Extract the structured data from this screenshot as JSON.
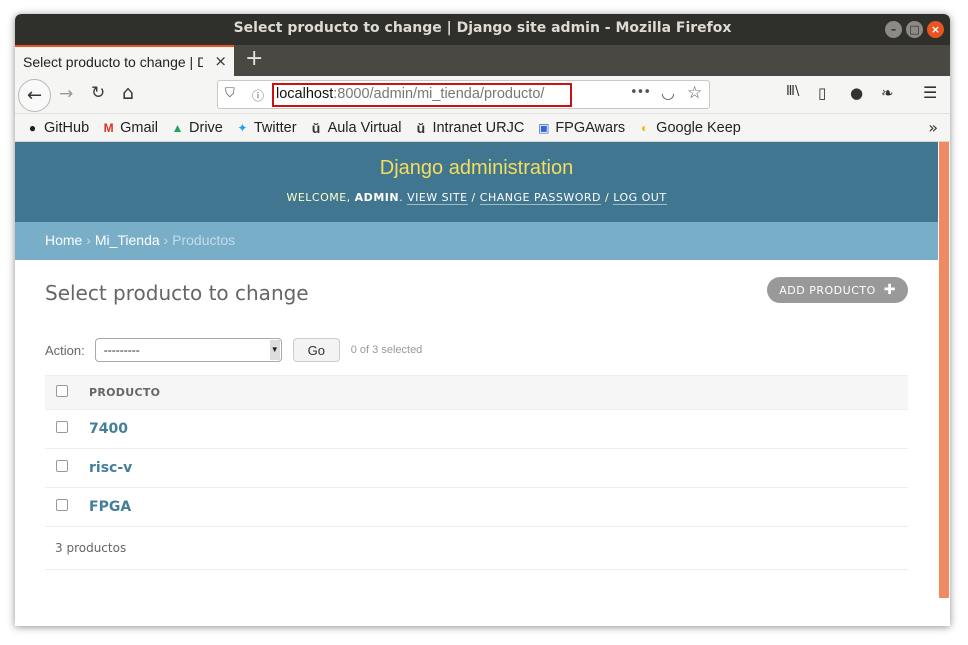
{
  "window": {
    "title": "Select producto to change | Django site admin - Mozilla Firefox",
    "controls": {
      "minimize": "–",
      "maximize": "□",
      "close": "×"
    }
  },
  "tabs": [
    {
      "label": "Select producto to change | Django site admin",
      "close": "×"
    }
  ],
  "new_tab": "+",
  "nav": {
    "back": "←",
    "forward": "→",
    "reload": "↻",
    "home": "⌂",
    "url_host": "localhost",
    "url_rest": ":8000/admin/mi_tienda/producto/",
    "page_actions": "•••",
    "pocket": "◡",
    "bookmark_star": "☆",
    "library": "Ⅲ\\",
    "sidebar": "▯",
    "account": "●",
    "extension": "❧",
    "menu": "☰"
  },
  "bookmarks": [
    {
      "label": "GitHub",
      "icon": "github-icon",
      "glyph": "●",
      "color": "#1b1f23"
    },
    {
      "label": "Gmail",
      "icon": "gmail-icon",
      "glyph": "M",
      "color": "#d93025"
    },
    {
      "label": "Drive",
      "icon": "drive-icon",
      "glyph": "▲",
      "color": "#1fa463"
    },
    {
      "label": "Twitter",
      "icon": "twitter-icon",
      "glyph": "✦",
      "color": "#1da1f2"
    },
    {
      "label": "Aula Virtual",
      "icon": "urjc-icon",
      "glyph": "ŭ",
      "color": "#333333"
    },
    {
      "label": "Intranet URJC",
      "icon": "urjc-icon",
      "glyph": "ŭ",
      "color": "#333333"
    },
    {
      "label": "FPGAwars",
      "icon": "fpgawars-icon",
      "glyph": "▣",
      "color": "#3367d6"
    },
    {
      "label": "Google Keep",
      "icon": "keep-icon",
      "glyph": "◐",
      "color": "#f6b400"
    }
  ],
  "bookmarks_overflow": "»",
  "django": {
    "branding": "Django administration",
    "welcome": "WELCOME, ",
    "user": "ADMIN",
    "user_suffix": ". ",
    "view_site": "VIEW SITE",
    "change_password": "CHANGE PASSWORD",
    "log_out": "LOG OUT",
    "sep": " / ",
    "breadcrumbs": {
      "home": "Home",
      "app": "Mi_Tienda",
      "current": "Productos",
      "sep": " › "
    },
    "page_title": "Select producto to change",
    "add_button": "ADD PRODUCTO",
    "add_plus": "✚",
    "action_label": "Action:",
    "action_value": "---------",
    "go_button": "Go",
    "selected_counter": "0 of 3 selected",
    "column_header": "PRODUCTO",
    "rows": [
      "7400",
      "risc-v",
      "FPGA"
    ],
    "paginator": "3 productos"
  },
  "colors": {
    "header_bg": "#417690",
    "branding": "#f5dd5d",
    "breadcrumb_bg": "#79aec8",
    "link": "#447e9b",
    "accent": "#e95420",
    "url_highlight": "#cc1111"
  }
}
